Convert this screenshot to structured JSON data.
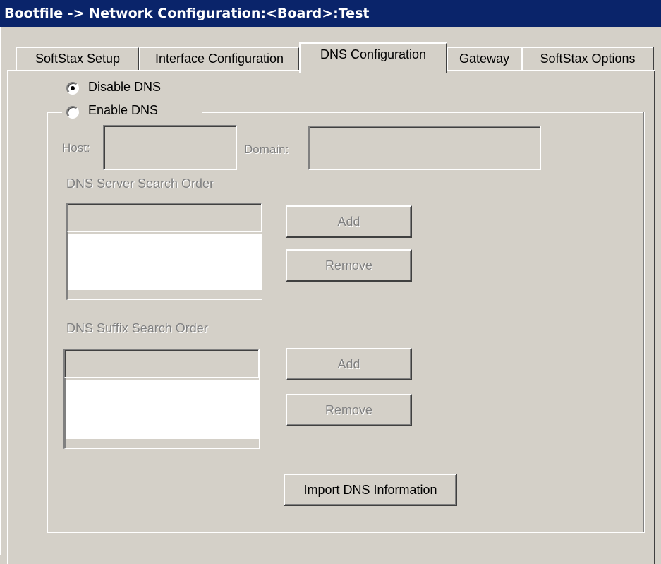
{
  "window": {
    "title": "Bootfile -> Network Configuration:<Board>:Test"
  },
  "tabs": [
    {
      "label": "SoftStax Setup",
      "active": false
    },
    {
      "label": "Interface Configuration",
      "active": false
    },
    {
      "label": "DNS Configuration",
      "active": true
    },
    {
      "label": "Gateway",
      "active": false
    },
    {
      "label": "SoftStax Options",
      "active": false
    }
  ],
  "dns_mode": {
    "disable_label": "Disable DNS",
    "enable_label": "Enable DNS",
    "selected": "disable"
  },
  "host": {
    "label": "Host:",
    "value": ""
  },
  "domain": {
    "label": "Domain:",
    "value": ""
  },
  "server_search": {
    "label": "DNS Server Search Order",
    "input_value": "",
    "add_label": "Add",
    "remove_label": "Remove"
  },
  "suffix_search": {
    "label": "DNS Suffix Search Order",
    "input_value": "",
    "add_label": "Add",
    "remove_label": "Remove"
  },
  "import_button": {
    "label": "Import DNS Information"
  },
  "colors": {
    "face": "#d4d0c8",
    "titlebar": "#0a246a",
    "disabled_text": "#808080"
  }
}
